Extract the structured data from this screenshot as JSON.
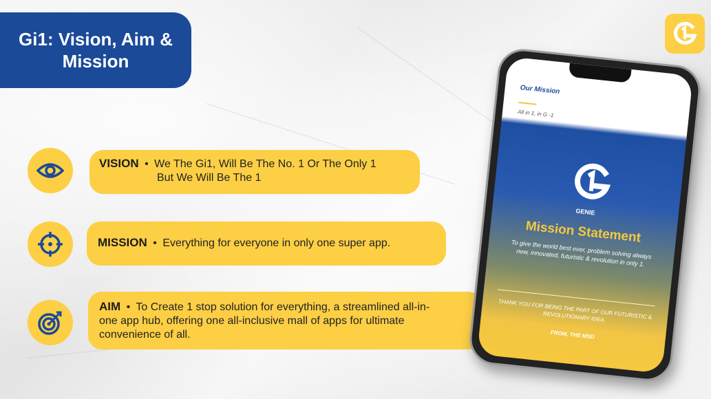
{
  "header": {
    "title_line1": "Gi1: Vision, Aim &",
    "title_line2": "Mission"
  },
  "brand": {
    "logo_icon": "gi1-logo-icon",
    "accent": "#fdcf45",
    "primary": "#1a4a98"
  },
  "items": [
    {
      "icon": "eye-icon",
      "heading": "VISION",
      "bullet": "•",
      "line1": "We The Gi1, Will  Be The No. 1 Or The Only 1",
      "line2": "But We  Will Be The 1"
    },
    {
      "icon": "target-crosshair-icon",
      "heading": "MISSION",
      "bullet": "•",
      "line1": "Everything for everyone in only one super app."
    },
    {
      "icon": "bullseye-arrow-icon",
      "heading": "AIM",
      "bullet": "•",
      "line1": "To Create 1 stop solution for everything, a streamlined all-in-",
      "line2": "one app hub, offering one all-inclusive mall of apps for ultimate",
      "line3": "convenience of all."
    }
  ],
  "phone": {
    "heading": "Our Mission",
    "subtitle": "All in 1, in G -1",
    "app_name": "GENIE",
    "statement_title": "Mission Statement",
    "statement_text": "To give the world best ever, problem solving always new, innovated, futuristic & revolution in only 1.",
    "thanks": "THANK YOU FOR BEING THE PART OF OUR FUTURISTIC & REVOLUTIONARY IDEA.",
    "from": "FROM, THE MSD"
  }
}
